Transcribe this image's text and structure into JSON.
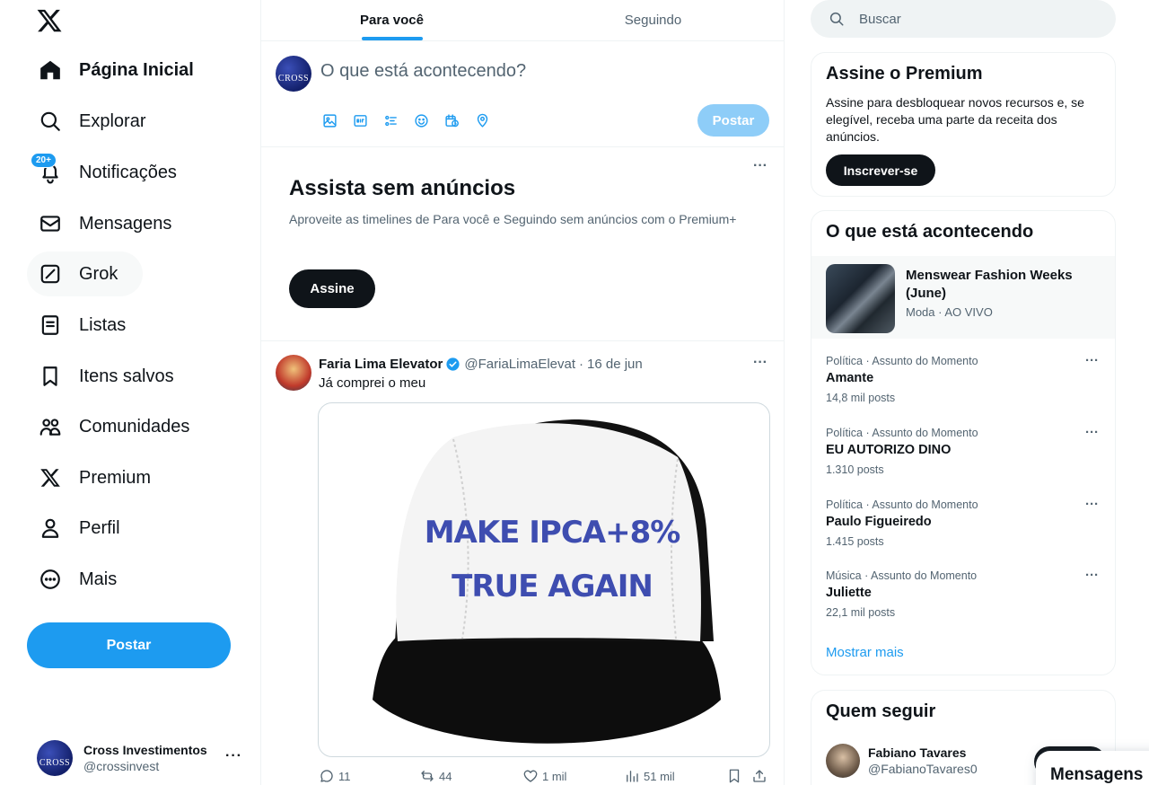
{
  "nav": {
    "items": [
      {
        "label": "Página Inicial",
        "icon": "home-icon"
      },
      {
        "label": "Explorar",
        "icon": "search-icon"
      },
      {
        "label": "Notificações",
        "icon": "bell-icon",
        "badge": "20+"
      },
      {
        "label": "Mensagens",
        "icon": "envelope-icon"
      },
      {
        "label": "Grok",
        "icon": "grok-icon"
      },
      {
        "label": "Listas",
        "icon": "list-icon"
      },
      {
        "label": "Itens salvos",
        "icon": "bookmark-icon"
      },
      {
        "label": "Comunidades",
        "icon": "communities-icon"
      },
      {
        "label": "Premium",
        "icon": "x-logo-icon"
      },
      {
        "label": "Perfil",
        "icon": "profile-icon"
      },
      {
        "label": "Mais",
        "icon": "more-circle-icon"
      }
    ],
    "post_label": "Postar"
  },
  "account": {
    "name": "Cross Investimentos",
    "handle": "@crossinvest",
    "avatar_text": "CROSS"
  },
  "tabs": [
    {
      "label": "Para você",
      "active": true
    },
    {
      "label": "Seguindo",
      "active": false
    }
  ],
  "composer": {
    "placeholder": "O que está acontecendo?",
    "avatar_text": "CROSS",
    "post_label": "Postar"
  },
  "promo": {
    "title": "Assista sem anúncios",
    "text": "Aproveite as timelines de Para você e Seguindo sem anúncios com o Premium+",
    "button": "Assine"
  },
  "tweet": {
    "name": "Faria Lima Elevator",
    "handle": "@FariaLimaElevat",
    "sep": "·",
    "date": "16 de jun",
    "text": "Já comprei o meu",
    "image_text_line1": "MAKE IPCA+8%",
    "image_text_line2": "TRUE AGAIN",
    "stats": {
      "replies": "11",
      "reposts": "44",
      "likes": "1 mil",
      "views": "51 mil"
    }
  },
  "search": {
    "placeholder": "Buscar"
  },
  "premium_card": {
    "title": "Assine o Premium",
    "text": "Assine para desbloquear novos recursos e, se elegível, receba uma parte da receita dos anúncios.",
    "button": "Inscrever-se"
  },
  "trends": {
    "title": "O que está acontecendo",
    "feature": {
      "title": "Menswear Fashion Weeks (June)",
      "meta": "Moda · AO VIVO"
    },
    "items": [
      {
        "category": "Política · Assunto do Momento",
        "name": "Amante",
        "count": "14,8 mil posts"
      },
      {
        "category": "Política · Assunto do Momento",
        "name": "EU AUTORIZO DINO",
        "count": "1.310 posts"
      },
      {
        "category": "Política · Assunto do Momento",
        "name": "Paulo Figueiredo",
        "count": "1.415 posts"
      },
      {
        "category": "Música · Assunto do Momento",
        "name": "Juliette",
        "count": "22,1 mil posts"
      }
    ],
    "show_more": "Mostrar mais"
  },
  "follow": {
    "title": "Quem seguir",
    "user": {
      "name": "Fabiano Tavares",
      "handle": "@FabianoTavares0"
    }
  },
  "messages_drawer": {
    "label": "Mensagens"
  },
  "colors": {
    "accent": "#1d9bf0",
    "text": "#0f1419",
    "muted": "#536471",
    "border": "#eff3f4"
  }
}
